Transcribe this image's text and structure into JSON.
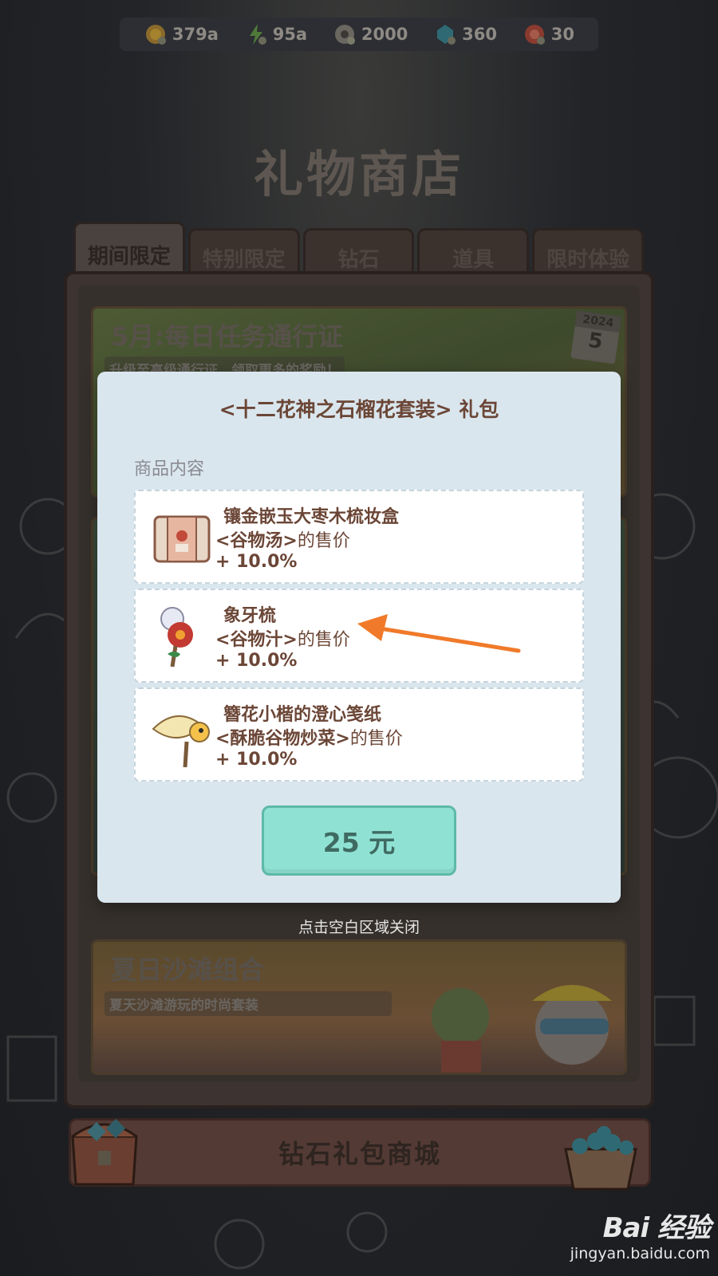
{
  "currencies": [
    {
      "icon": "gold-coin-icon",
      "value": "379a"
    },
    {
      "icon": "energy-bolt-icon",
      "value": "95a"
    },
    {
      "icon": "gear-token-icon",
      "value": "2000"
    },
    {
      "icon": "diamond-icon",
      "value": "360"
    },
    {
      "icon": "ticket-icon",
      "value": "30"
    }
  ],
  "shop": {
    "title": "礼物商店",
    "tabs": [
      "期间限定",
      "特别限定",
      "钻石",
      "道具",
      "限时体验"
    ],
    "active_tab": "期间限定",
    "banners": {
      "pass_title": "5月:每日任务通行证",
      "pass_subtitle": "升级至高级通行证，领取更多的奖励！",
      "pass_calendar_year": "2024",
      "pass_calendar_day": "5",
      "summer_title": "夏日沙滩组合",
      "summer_subtitle": "夏天沙滩游玩的时尚套装"
    },
    "mall_label": "钻石礼包商城"
  },
  "modal": {
    "title": "<十二花神之石榴花套装> 礼包",
    "section_label": "商品内容",
    "items": [
      {
        "name": "镶金嵌玉大枣木梳妆盒",
        "effect_target": "<谷物汤>",
        "effect_suffix": "的售价",
        "value": "+ 10.0%"
      },
      {
        "name": "象牙梳",
        "effect_target": "<谷物汁>",
        "effect_suffix": "的售价",
        "value": "+ 10.0%"
      },
      {
        "name": "簪花小楷的澄心笺纸",
        "effect_target": "<酥脆谷物炒菜>",
        "effect_suffix": "的售价",
        "value": "+ 10.0%"
      }
    ],
    "price_label": "25 元",
    "close_hint": "点击空白区域关闭"
  },
  "watermark": {
    "brand": "Bai  经验",
    "url": "jingyan.baidu.com"
  },
  "colors": {
    "accent": "#8fe2d3",
    "modal_bg": "#dae6ee",
    "text_brown": "#6b4636",
    "arrow": "#f07a2a"
  }
}
